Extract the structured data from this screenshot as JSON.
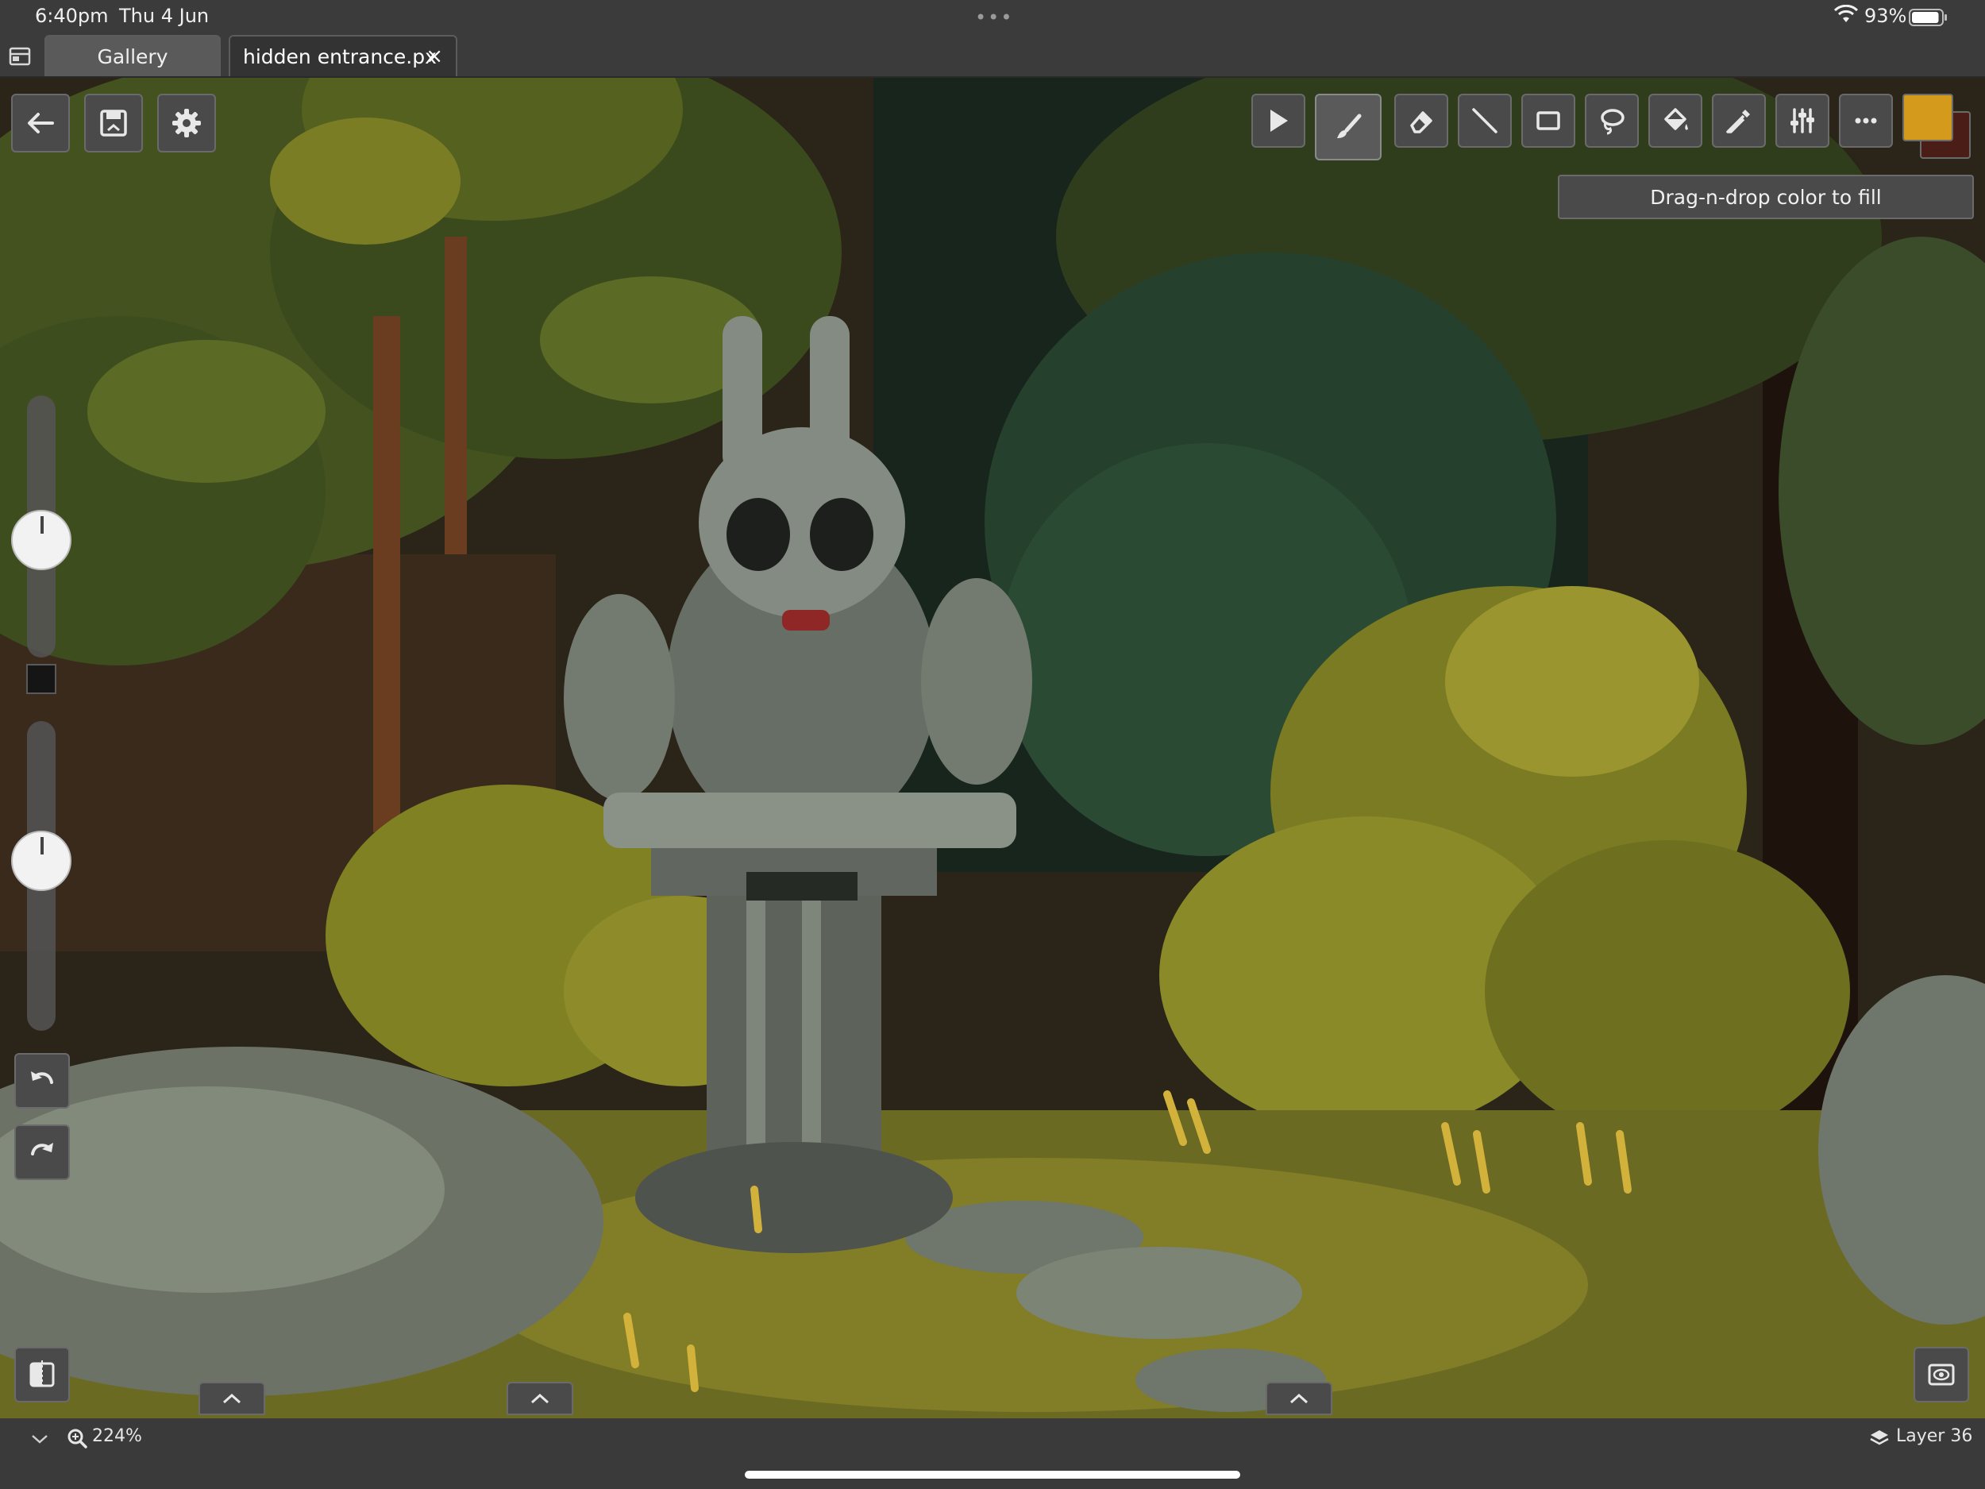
{
  "status_bar": {
    "time": "6:40pm",
    "date": "Thu 4 Jun",
    "multitask_dots": "•••",
    "battery_percent": "93%",
    "battery_level": 0.93
  },
  "tabs": [
    {
      "label": "Gallery",
      "active": false
    },
    {
      "label": "hidden entrance.px",
      "active": true,
      "close": "×"
    }
  ],
  "toolbar": {
    "tools": [
      {
        "name": "select",
        "icon": "cursor-arrow-icon"
      },
      {
        "name": "brush",
        "icon": "brush-icon",
        "active": true
      },
      {
        "name": "eraser",
        "icon": "eraser-icon"
      },
      {
        "name": "line",
        "icon": "line-icon"
      },
      {
        "name": "rectangle",
        "icon": "rectangle-icon"
      },
      {
        "name": "lasso",
        "icon": "lasso-icon"
      },
      {
        "name": "fill",
        "icon": "fill-bucket-icon"
      },
      {
        "name": "eyedropper",
        "icon": "eyedropper-icon"
      },
      {
        "name": "adjustments",
        "icon": "sliders-icon"
      },
      {
        "name": "more",
        "icon": "more-dots-icon"
      }
    ],
    "primary_color": "#d39a1c",
    "secondary_color": "#4a1e17"
  },
  "tooltip": "Drag-n-drop color to fill",
  "left_controls": {
    "brush_size_level": 0.45,
    "opacity_level": 0.55
  },
  "bottom_bar": {
    "zoom": "224%",
    "layer": "Layer 36"
  }
}
